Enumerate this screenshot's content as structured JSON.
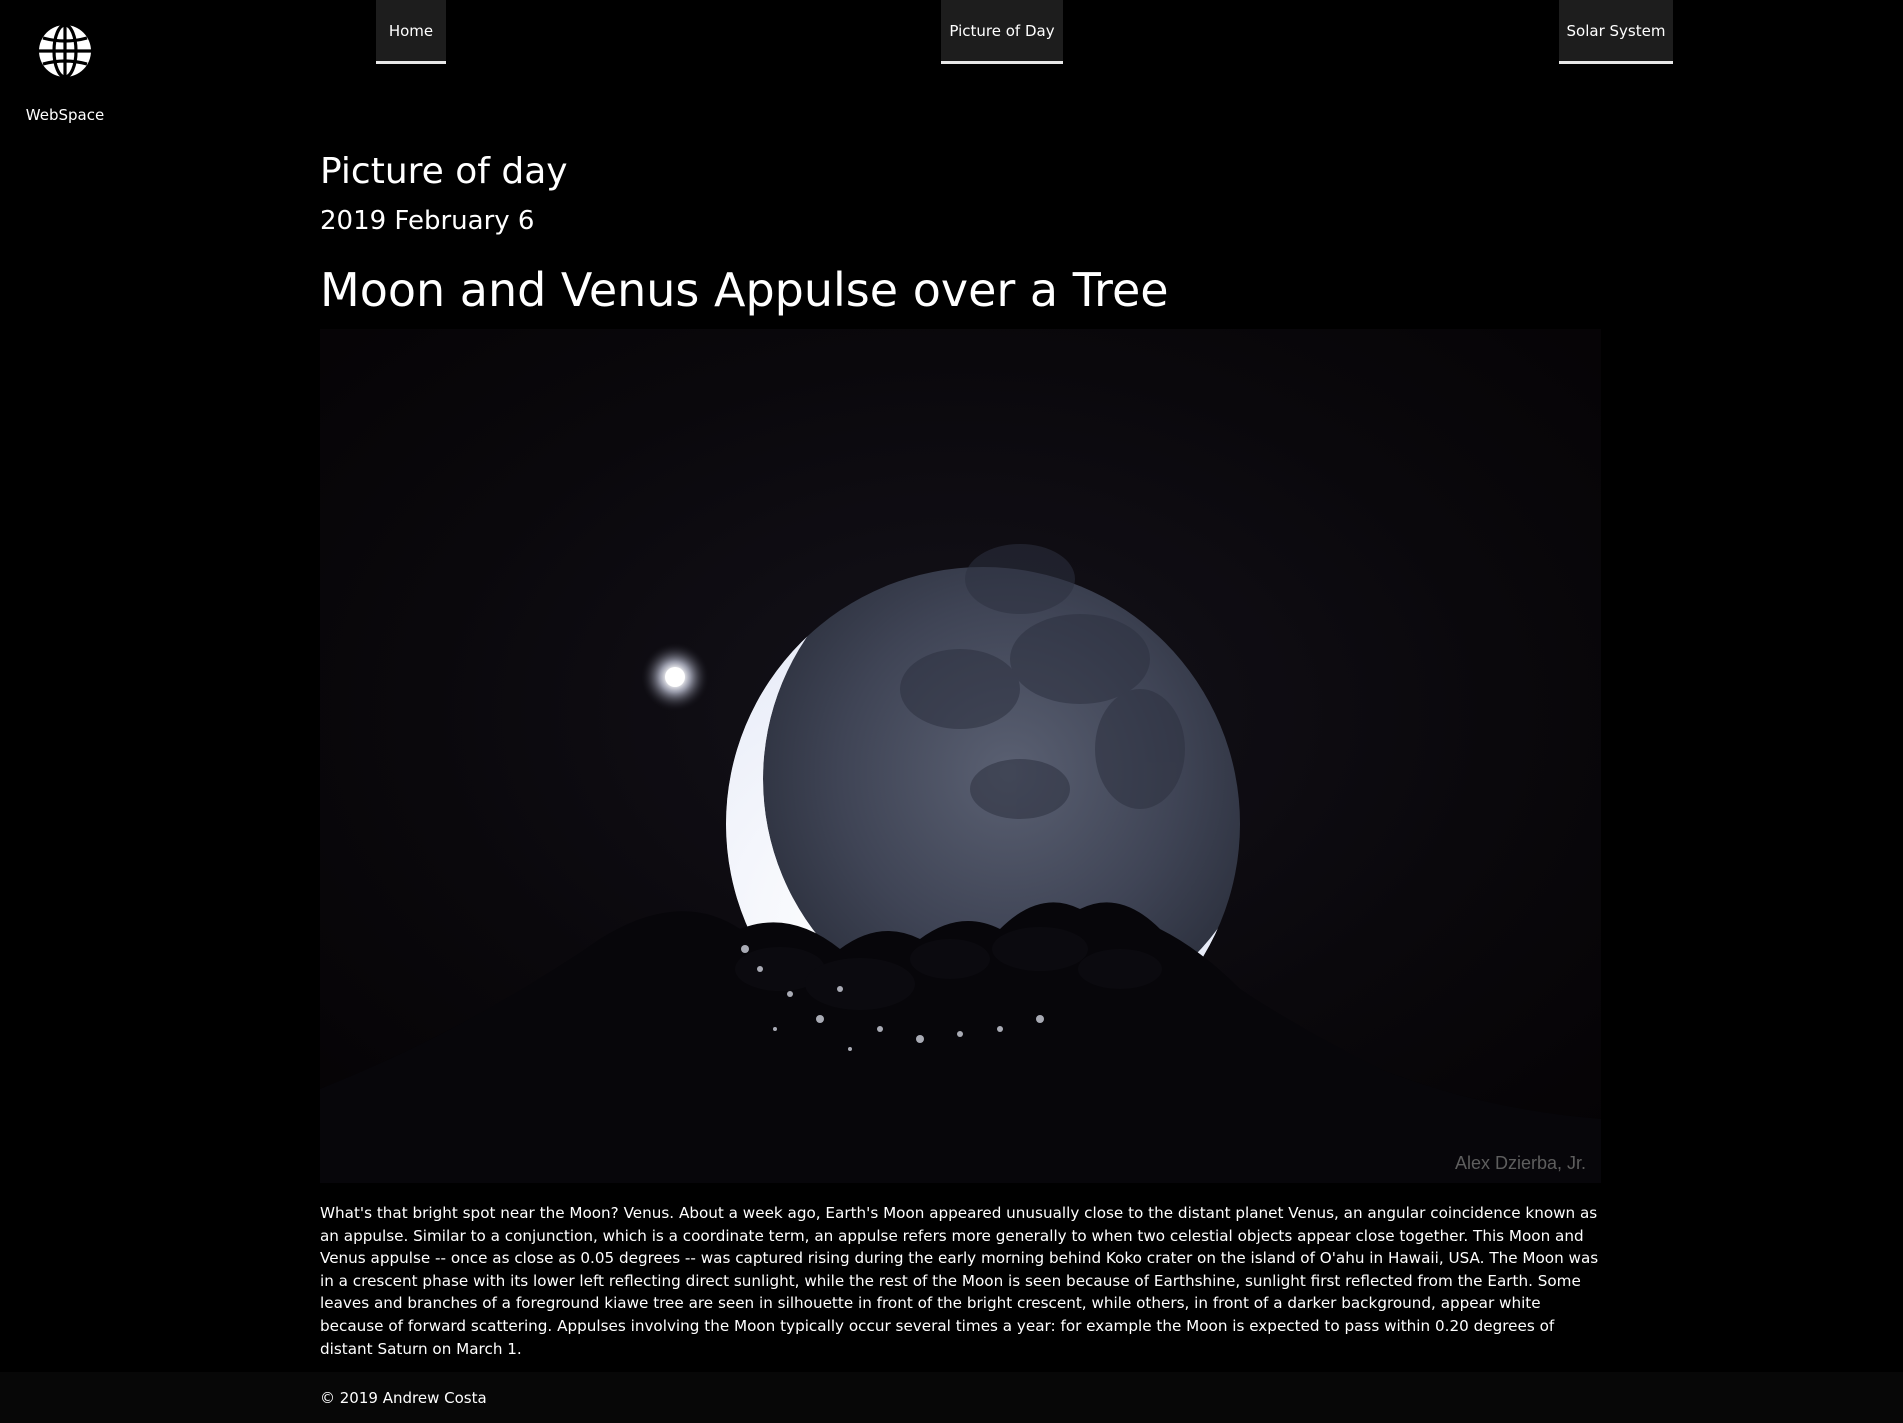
{
  "brand": {
    "name": "WebSpace",
    "logo_icon": "globe-icon"
  },
  "nav": [
    {
      "label": "Home"
    },
    {
      "label": "Picture of Day"
    },
    {
      "label": "Solar System"
    }
  ],
  "page": {
    "section_title": "Picture of day",
    "date": "2019 February 6",
    "title": "Moon and Venus Appulse over a Tree",
    "image": {
      "credit": "Alex Dzierba, Jr."
    },
    "explanation": "What's that bright spot near the Moon? Venus. About a week ago, Earth's Moon appeared unusually close to the distant planet Venus, an angular coincidence known as an appulse. Similar to a conjunction, which is a coordinate term, an appulse refers more generally to when two celestial objects appear close together. This Moon and Venus appulse -- once as close as 0.05 degrees -- was captured rising during the early morning behind Koko crater on the island of O'ahu in Hawaii, USA. The Moon was in a crescent phase with its lower left reflecting direct sunlight, while the rest of the Moon is seen because of Earthshine, sunlight first reflected from the Earth. Some leaves and branches of a foreground kiawe tree are seen in silhouette in front of the bright crescent, while others, in front of a darker background, appear white because of forward scattering. Appulses involving the Moon typically occur several times a year: for example the Moon is expected to pass within 0.20 degrees of distant Saturn on March 1."
  },
  "footer": {
    "copyright": "© 2019 Andrew Costa"
  }
}
